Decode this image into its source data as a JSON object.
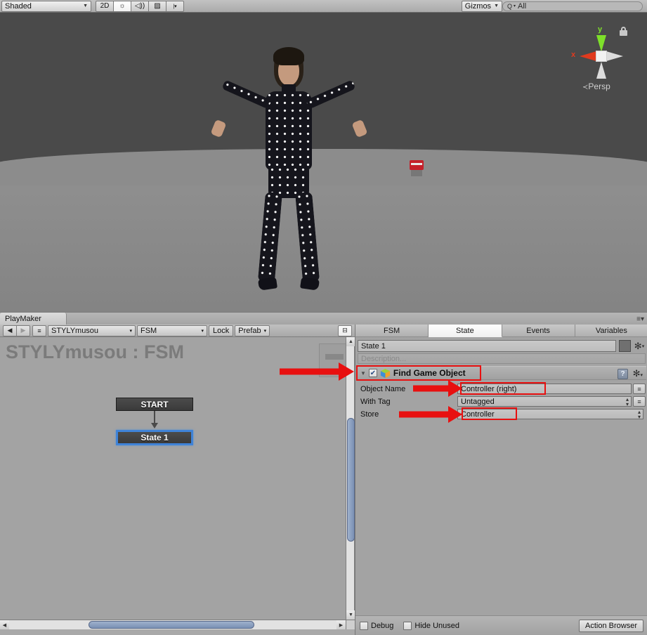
{
  "scene_toolbar": {
    "shading_mode": "Shaded",
    "view_2d": "2D",
    "lighting_icon": "sun-icon",
    "audio_icon": "speaker-icon",
    "effects_icon": "image-icon",
    "gizmos": "Gizmos",
    "search_placeholder": "All",
    "search_value": "All"
  },
  "scene_view": {
    "gizmo": {
      "x_label": "x",
      "y_label": "y",
      "projection": "Persp",
      "projection_prefix": "≺"
    },
    "lock_icon": "lock-icon",
    "character_name": "mocap-character",
    "prop_name": "red-prop"
  },
  "playmaker": {
    "window_tab": "PlayMaker",
    "toolbar": {
      "back": "◀",
      "forward": "▶",
      "menu": "≡",
      "object_selector": "STYLYmusou",
      "fsm_selector": "FSM",
      "lock": "Lock",
      "prefab": "Prefab",
      "layout_icon": "layout-icon"
    },
    "graph": {
      "title": "STYLYmusou : FSM",
      "nodes": [
        {
          "label": "START",
          "selected": false
        },
        {
          "label": "State 1",
          "selected": true
        }
      ]
    }
  },
  "inspector": {
    "tabs": [
      {
        "label": "FSM",
        "active": false
      },
      {
        "label": "State",
        "active": true
      },
      {
        "label": "Events",
        "active": false
      },
      {
        "label": "Variables",
        "active": false
      }
    ],
    "state_name": "State 1",
    "description_placeholder": "Description...",
    "action": {
      "title": "Find Game Object",
      "enabled": true,
      "expanded": true,
      "icon": "cube-icon",
      "help_icon": "help-book-icon",
      "gear_icon": "gear-icon",
      "fields": [
        {
          "label": "Object Name",
          "value": "Controller (right)",
          "type": "text",
          "has_eq": true,
          "highlighted": true
        },
        {
          "label": "With Tag",
          "value": "Untagged",
          "type": "popup",
          "has_eq": true,
          "highlighted": false
        },
        {
          "label": "Store",
          "value": "Controller",
          "type": "popup",
          "has_eq": false,
          "highlighted": true
        }
      ]
    },
    "footer": {
      "debug_label": "Debug",
      "debug_checked": false,
      "hide_unused_label": "Hide Unused",
      "hide_unused_checked": false,
      "action_browser_label": "Action Browser"
    }
  },
  "annotations": {
    "highlight_color": "#e81010",
    "arrows": [
      {
        "target": "action-header"
      },
      {
        "target": "object-name-field"
      },
      {
        "target": "store-field"
      }
    ],
    "boxes": [
      {
        "target": "action-header"
      },
      {
        "target": "object-name-value"
      },
      {
        "target": "store-value"
      }
    ]
  }
}
